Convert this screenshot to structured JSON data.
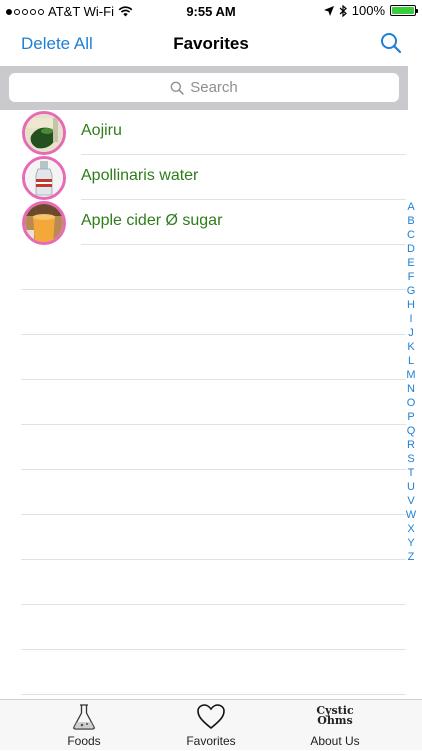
{
  "status_bar": {
    "carrier": "AT&T Wi-Fi",
    "time": "9:55 AM",
    "battery": "100%",
    "battery_color": "#3bcc3b"
  },
  "nav": {
    "delete_all": "Delete All",
    "title": "Favorites"
  },
  "search": {
    "placeholder": "Search"
  },
  "favorites": [
    {
      "name": "Aojiru",
      "thumb": "green-juice"
    },
    {
      "name": "Apollinaris water",
      "thumb": "water-bottle"
    },
    {
      "name": "Apple cider Ø sugar",
      "thumb": "cider"
    }
  ],
  "index_letters": [
    "A",
    "B",
    "C",
    "D",
    "E",
    "F",
    "G",
    "H",
    "I",
    "J",
    "K",
    "L",
    "M",
    "N",
    "O",
    "P",
    "Q",
    "R",
    "S",
    "T",
    "U",
    "V",
    "W",
    "X",
    "Y",
    "Z"
  ],
  "tabs": [
    {
      "label": "Foods",
      "icon": "flask-icon"
    },
    {
      "label": "Favorites",
      "icon": "heart-icon"
    },
    {
      "label": "About Us",
      "icon": "cystic-logo-icon"
    }
  ],
  "about_logo_text": "Cystic Ohms",
  "colors": {
    "accent": "#1e7fd6",
    "item_text": "#2e7d1b",
    "avatar_ring": "#e86ab7"
  }
}
